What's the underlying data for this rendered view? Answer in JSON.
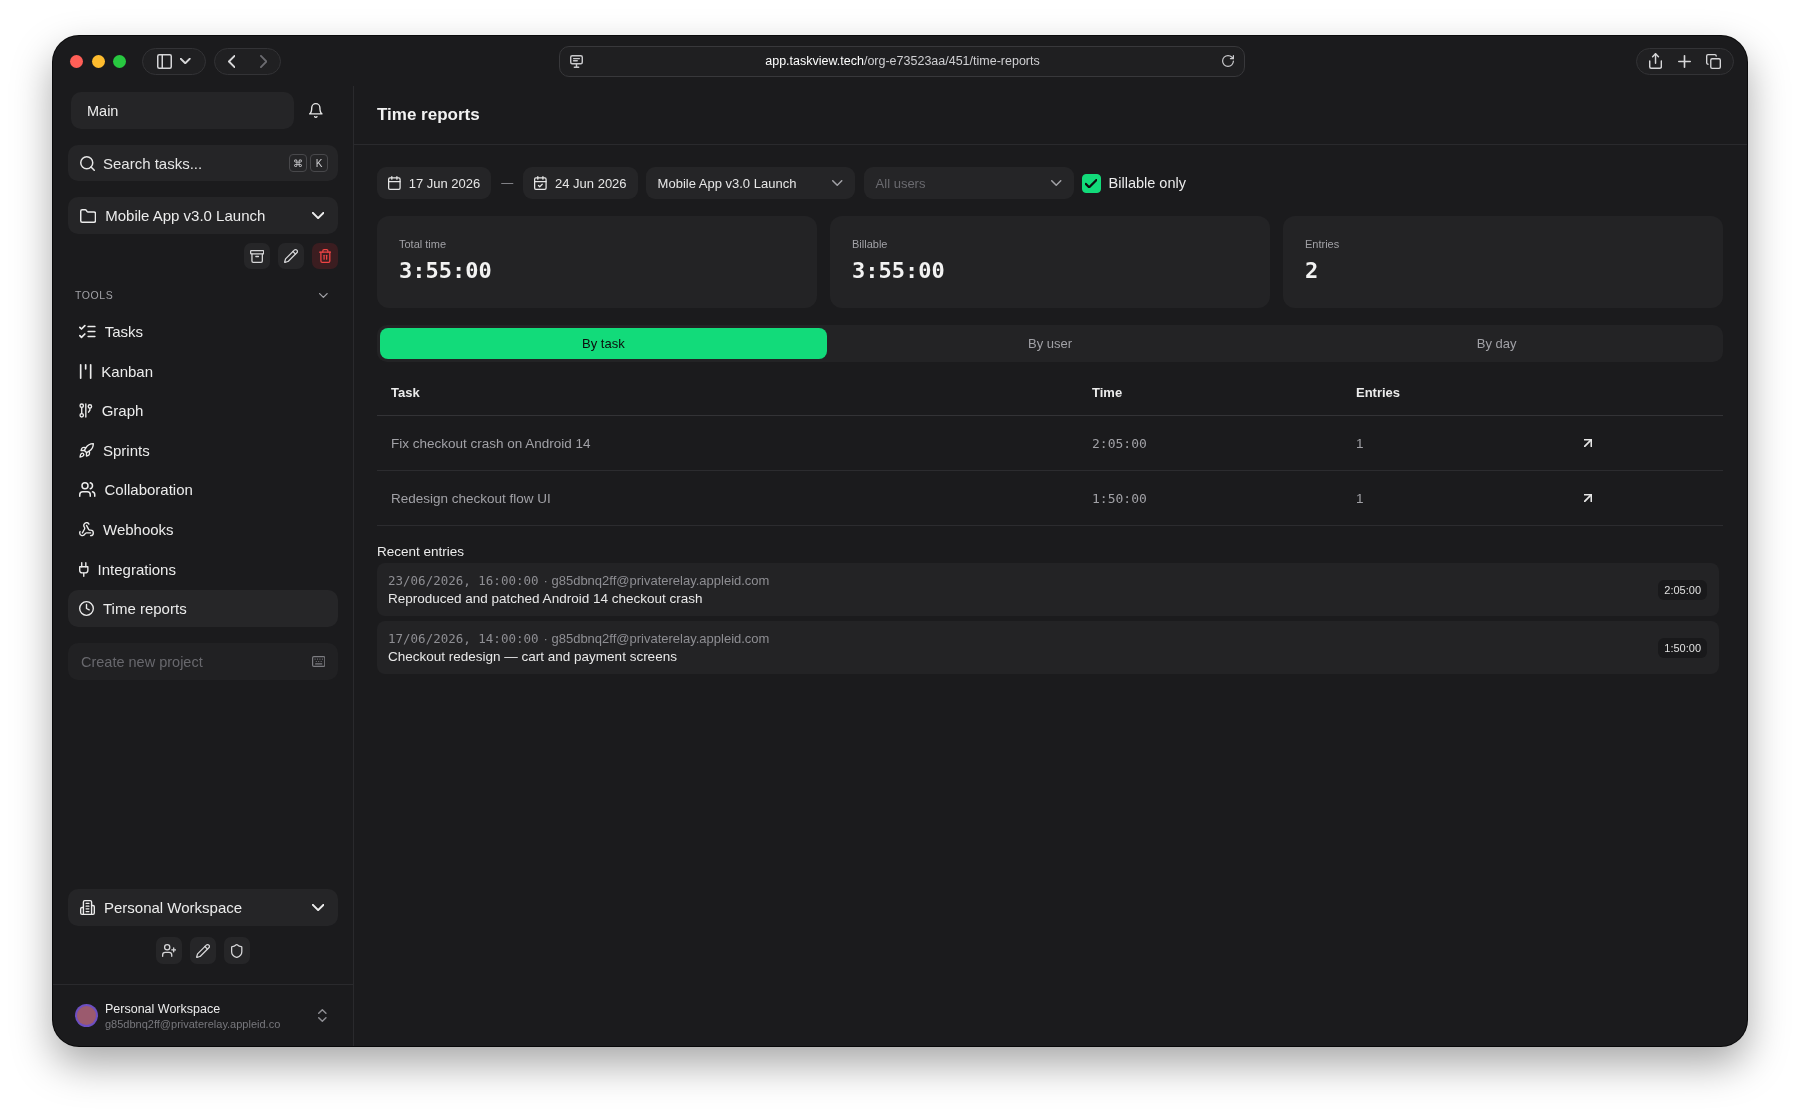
{
  "browser": {
    "url": {
      "host": "app.taskview.tech",
      "path": "/org-e73523aa/451/time-reports"
    },
    "can_go_forward": false
  },
  "sidebar": {
    "view": {
      "value": "Main"
    },
    "search": {
      "placeholder": "Search tasks...",
      "shortcut": [
        "⌘",
        "K"
      ]
    },
    "project": {
      "value": "Mobile App v3.0 Launch"
    },
    "tools": {
      "heading": "TOOLS",
      "expanded": true,
      "items": [
        {
          "label": "Tasks",
          "selected": false
        },
        {
          "label": "Kanban",
          "selected": false
        },
        {
          "label": "Graph",
          "selected": false
        },
        {
          "label": "Sprints",
          "selected": false
        },
        {
          "label": "Collaboration",
          "selected": false
        },
        {
          "label": "Webhooks",
          "selected": false
        },
        {
          "label": "Integrations",
          "selected": false
        },
        {
          "label": "Time reports",
          "selected": true
        }
      ]
    },
    "create_project": {
      "placeholder": "Create new project"
    },
    "workspace": {
      "value": "Personal Workspace"
    },
    "profile": {
      "name": "Personal Workspace",
      "email": "g85dbnq2ff@privaterelay.appleid.co"
    }
  },
  "main": {
    "title": "Time reports",
    "filters": {
      "date_from": "17 Jun 2026",
      "separator": "—",
      "date_to": "24 Jun 2026",
      "project": "Mobile App v3.0 Launch",
      "users": {
        "placeholder": "All users"
      },
      "billable": {
        "label": "Billable only",
        "checked": true
      }
    },
    "stats": [
      {
        "label": "Total time",
        "value": "3:55:00"
      },
      {
        "label": "Billable",
        "value": "3:55:00"
      },
      {
        "label": "Entries",
        "value": "2"
      }
    ],
    "tabs": [
      {
        "label": "By task",
        "selected": true
      },
      {
        "label": "By user",
        "selected": false
      },
      {
        "label": "By day",
        "selected": false
      }
    ],
    "table": {
      "columns": [
        "Task",
        "Time",
        "Entries"
      ],
      "rows": [
        {
          "task": "Fix checkout crash on Android 14",
          "time": "2:05:00",
          "entries": "1"
        },
        {
          "task": "Redesign checkout flow UI",
          "time": "1:50:00",
          "entries": "1"
        }
      ]
    },
    "recent": {
      "heading": "Recent entries",
      "entries": [
        {
          "timestamp": "23/06/2026, 16:00:00",
          "user": "· g85dbnq2ff@privaterelay.appleid.com",
          "description": "Reproduced and patched Android 14 checkout crash",
          "duration": "2:05:00"
        },
        {
          "timestamp": "17/06/2026, 14:00:00",
          "user": "· g85dbnq2ff@privaterelay.appleid.com",
          "description": "Checkout redesign — cart and payment screens",
          "duration": "1:50:00"
        }
      ]
    }
  }
}
